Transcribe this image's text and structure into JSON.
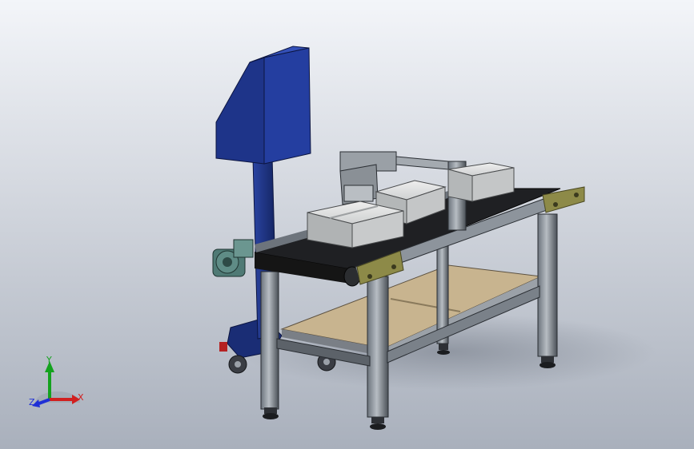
{
  "viewport": {
    "background_top": "#f3f5f9",
    "background_bottom": "#a9b0bc"
  },
  "triad": {
    "x_label": "X",
    "y_label": "Y",
    "z_label": "Z",
    "x_color": "#d11f1f",
    "y_color": "#14a21e",
    "z_color": "#1f2fd6"
  },
  "model": {
    "description_icons": [
      "display-kiosk",
      "conveyor-belt",
      "aluminum-frame",
      "carton-box",
      "gear-motor",
      "caster-wheel",
      "leveling-foot"
    ],
    "colors": {
      "kiosk_blue": "#1b2f7a",
      "frame_gray": "#8d949c",
      "frame_dark": "#2a2e33",
      "belt_black": "#151515",
      "shelf_tan": "#c8b48f",
      "bracket_olive": "#8d8a48",
      "box_gray": "#c9cbcc",
      "motor_green": "#4f7a75"
    }
  }
}
